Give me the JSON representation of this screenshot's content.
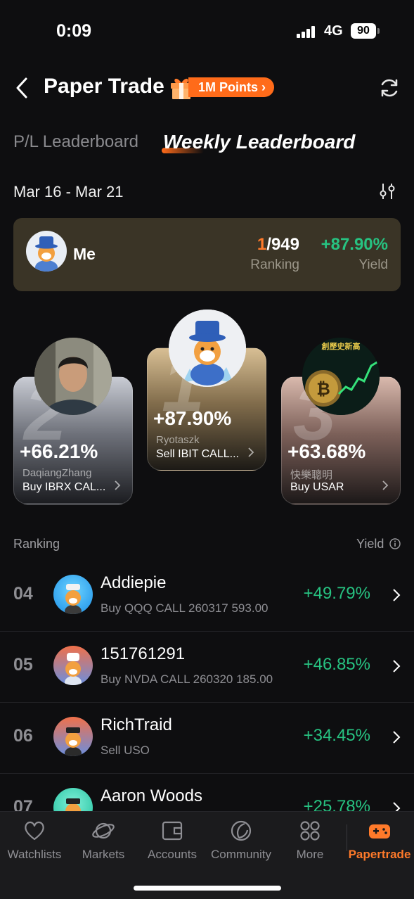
{
  "status_bar": {
    "time": "0:09",
    "network": "4G",
    "battery": "90"
  },
  "header": {
    "title": "Paper Trade",
    "points_badge": "1M Points ›"
  },
  "tabs": [
    {
      "label": "P/L Leaderboard",
      "active": false
    },
    {
      "label": "Weekly Leaderboard",
      "active": true
    }
  ],
  "date_range": "Mar 16 - Mar 21",
  "me": {
    "name": "Me",
    "rank": "1",
    "total": "/949",
    "rank_label": "Ranking",
    "yield": "+87.90%",
    "yield_label": "Yield"
  },
  "podium": [
    {
      "place": "2",
      "yield": "+66.21%",
      "user": "DaqiangZhang",
      "trade": "Buy IBRX CAL..."
    },
    {
      "place": "1",
      "yield": "+87.90%",
      "user": "Ryotaszk",
      "trade": "Sell IBIT CALL..."
    },
    {
      "place": "3",
      "yield": "+63.68%",
      "user": "快樂聰明",
      "trade": "Buy USAR",
      "avatar_text": "創歷史新高"
    }
  ],
  "list_header": {
    "ranking": "Ranking",
    "yield": "Yield"
  },
  "rows": [
    {
      "rank": "04",
      "name": "Addiepie",
      "trade": "Buy QQQ CALL 260317 593.00",
      "yield": "+49.79%"
    },
    {
      "rank": "05",
      "name": "151761291",
      "trade": "Buy NVDA CALL 260320 185.00",
      "yield": "+46.85%"
    },
    {
      "rank": "06",
      "name": "RichTraid",
      "trade": "Sell USO",
      "yield": "+34.45%"
    },
    {
      "rank": "07",
      "name": "Aaron Woods",
      "trade": "",
      "yield": "+25.78%"
    }
  ],
  "nav": [
    {
      "label": "Watchlists",
      "icon": "heart-icon"
    },
    {
      "label": "Markets",
      "icon": "planet-icon"
    },
    {
      "label": "Accounts",
      "icon": "wallet-icon"
    },
    {
      "label": "Community",
      "icon": "community-icon"
    },
    {
      "label": "More",
      "icon": "grid-icon"
    },
    {
      "label": "Papertrade",
      "icon": "gamepad-icon",
      "active": true
    }
  ],
  "colors": {
    "accent": "#ff7a2a",
    "positive": "#27c281",
    "me_card": "#3a3426"
  }
}
